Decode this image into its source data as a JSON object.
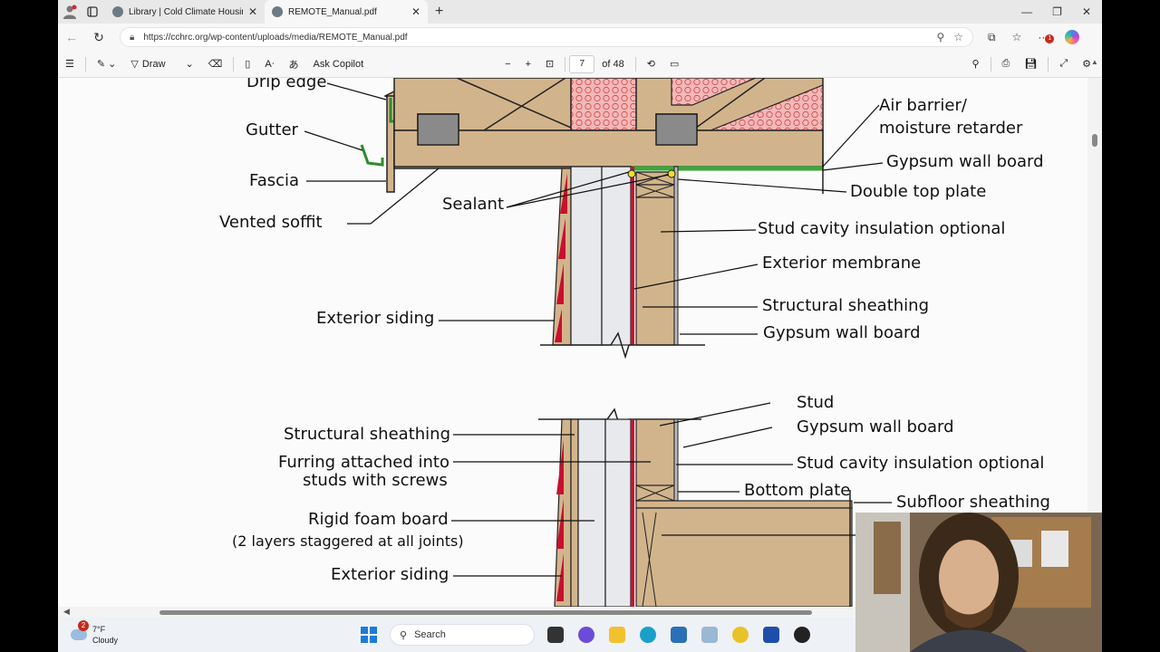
{
  "browser": {
    "tabs": [
      {
        "title": "Library | Cold Climate Housing Re",
        "active": false
      },
      {
        "title": "REMOTE_Manual.pdf",
        "active": true
      }
    ],
    "url": "https://cchrc.org/wp-content/uploads/media/REMOTE_Manual.pdf",
    "notification_badge": "1"
  },
  "pdf_toolbar": {
    "draw_label": "Draw",
    "ask_copilot_label": "Ask Copilot",
    "page_number": "7",
    "page_total": "of 48"
  },
  "diagram_top": {
    "drip_edge": "Drip edge",
    "gutter": "Gutter",
    "fascia": "Fascia",
    "vented_soffit": "Vented soffit",
    "sealant": "Sealant",
    "exterior_siding": "Exterior siding",
    "air_barrier_1": "Air barrier/",
    "air_barrier_2": "moisture retarder",
    "gypsum_wall_board_top": "Gypsum wall board",
    "double_top_plate": "Double top plate",
    "stud_cavity": "Stud cavity insulation optional",
    "exterior_membrane": "Exterior membrane",
    "structural_sheathing": "Structural sheathing",
    "gypsum_wall_board": "Gypsum wall board"
  },
  "diagram_bottom": {
    "structural_sheathing": "Structural sheathing",
    "furring_1": "Furring attached into",
    "furring_2": "studs with screws",
    "rigid_foam": "Rigid foam board",
    "rigid_foam_note": "(2  layers staggered at all joints)",
    "exterior_siding": "Exterior siding",
    "stud": "Stud",
    "gypsum_wall_board": "Gypsum wall board",
    "stud_cavity": "Stud cavity insulation optional",
    "bottom_plate": "Bottom plate",
    "subfloor_sheathing": "Subfloor sheathing"
  },
  "taskbar": {
    "weather_temp": "7°F",
    "weather_desc": "Cloudy",
    "weather_badge": "2",
    "search_label": "Search"
  }
}
